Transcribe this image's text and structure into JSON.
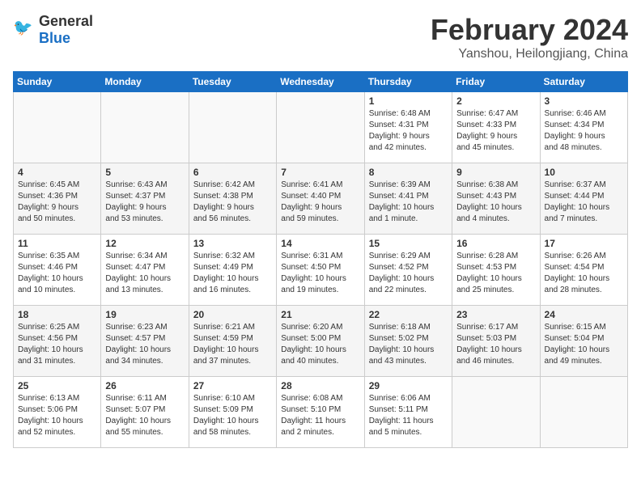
{
  "header": {
    "logo_general": "General",
    "logo_blue": "Blue",
    "title": "February 2024",
    "subtitle": "Yanshou, Heilongjiang, China"
  },
  "calendar": {
    "weekdays": [
      "Sunday",
      "Monday",
      "Tuesday",
      "Wednesday",
      "Thursday",
      "Friday",
      "Saturday"
    ],
    "weeks": [
      [
        {
          "day": "",
          "info": ""
        },
        {
          "day": "",
          "info": ""
        },
        {
          "day": "",
          "info": ""
        },
        {
          "day": "",
          "info": ""
        },
        {
          "day": "1",
          "info": "Sunrise: 6:48 AM\nSunset: 4:31 PM\nDaylight: 9 hours\nand 42 minutes."
        },
        {
          "day": "2",
          "info": "Sunrise: 6:47 AM\nSunset: 4:33 PM\nDaylight: 9 hours\nand 45 minutes."
        },
        {
          "day": "3",
          "info": "Sunrise: 6:46 AM\nSunset: 4:34 PM\nDaylight: 9 hours\nand 48 minutes."
        }
      ],
      [
        {
          "day": "4",
          "info": "Sunrise: 6:45 AM\nSunset: 4:36 PM\nDaylight: 9 hours\nand 50 minutes."
        },
        {
          "day": "5",
          "info": "Sunrise: 6:43 AM\nSunset: 4:37 PM\nDaylight: 9 hours\nand 53 minutes."
        },
        {
          "day": "6",
          "info": "Sunrise: 6:42 AM\nSunset: 4:38 PM\nDaylight: 9 hours\nand 56 minutes."
        },
        {
          "day": "7",
          "info": "Sunrise: 6:41 AM\nSunset: 4:40 PM\nDaylight: 9 hours\nand 59 minutes."
        },
        {
          "day": "8",
          "info": "Sunrise: 6:39 AM\nSunset: 4:41 PM\nDaylight: 10 hours\nand 1 minute."
        },
        {
          "day": "9",
          "info": "Sunrise: 6:38 AM\nSunset: 4:43 PM\nDaylight: 10 hours\nand 4 minutes."
        },
        {
          "day": "10",
          "info": "Sunrise: 6:37 AM\nSunset: 4:44 PM\nDaylight: 10 hours\nand 7 minutes."
        }
      ],
      [
        {
          "day": "11",
          "info": "Sunrise: 6:35 AM\nSunset: 4:46 PM\nDaylight: 10 hours\nand 10 minutes."
        },
        {
          "day": "12",
          "info": "Sunrise: 6:34 AM\nSunset: 4:47 PM\nDaylight: 10 hours\nand 13 minutes."
        },
        {
          "day": "13",
          "info": "Sunrise: 6:32 AM\nSunset: 4:49 PM\nDaylight: 10 hours\nand 16 minutes."
        },
        {
          "day": "14",
          "info": "Sunrise: 6:31 AM\nSunset: 4:50 PM\nDaylight: 10 hours\nand 19 minutes."
        },
        {
          "day": "15",
          "info": "Sunrise: 6:29 AM\nSunset: 4:52 PM\nDaylight: 10 hours\nand 22 minutes."
        },
        {
          "day": "16",
          "info": "Sunrise: 6:28 AM\nSunset: 4:53 PM\nDaylight: 10 hours\nand 25 minutes."
        },
        {
          "day": "17",
          "info": "Sunrise: 6:26 AM\nSunset: 4:54 PM\nDaylight: 10 hours\nand 28 minutes."
        }
      ],
      [
        {
          "day": "18",
          "info": "Sunrise: 6:25 AM\nSunset: 4:56 PM\nDaylight: 10 hours\nand 31 minutes."
        },
        {
          "day": "19",
          "info": "Sunrise: 6:23 AM\nSunset: 4:57 PM\nDaylight: 10 hours\nand 34 minutes."
        },
        {
          "day": "20",
          "info": "Sunrise: 6:21 AM\nSunset: 4:59 PM\nDaylight: 10 hours\nand 37 minutes."
        },
        {
          "day": "21",
          "info": "Sunrise: 6:20 AM\nSunset: 5:00 PM\nDaylight: 10 hours\nand 40 minutes."
        },
        {
          "day": "22",
          "info": "Sunrise: 6:18 AM\nSunset: 5:02 PM\nDaylight: 10 hours\nand 43 minutes."
        },
        {
          "day": "23",
          "info": "Sunrise: 6:17 AM\nSunset: 5:03 PM\nDaylight: 10 hours\nand 46 minutes."
        },
        {
          "day": "24",
          "info": "Sunrise: 6:15 AM\nSunset: 5:04 PM\nDaylight: 10 hours\nand 49 minutes."
        }
      ],
      [
        {
          "day": "25",
          "info": "Sunrise: 6:13 AM\nSunset: 5:06 PM\nDaylight: 10 hours\nand 52 minutes."
        },
        {
          "day": "26",
          "info": "Sunrise: 6:11 AM\nSunset: 5:07 PM\nDaylight: 10 hours\nand 55 minutes."
        },
        {
          "day": "27",
          "info": "Sunrise: 6:10 AM\nSunset: 5:09 PM\nDaylight: 10 hours\nand 58 minutes."
        },
        {
          "day": "28",
          "info": "Sunrise: 6:08 AM\nSunset: 5:10 PM\nDaylight: 11 hours\nand 2 minutes."
        },
        {
          "day": "29",
          "info": "Sunrise: 6:06 AM\nSunset: 5:11 PM\nDaylight: 11 hours\nand 5 minutes."
        },
        {
          "day": "",
          "info": ""
        },
        {
          "day": "",
          "info": ""
        }
      ]
    ]
  }
}
